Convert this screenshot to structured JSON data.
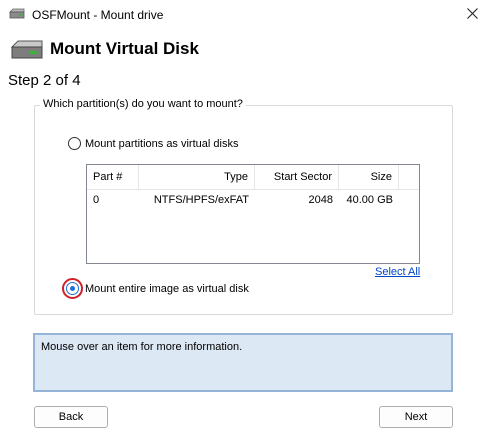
{
  "window": {
    "title": "OSFMount - Mount drive",
    "app_icon": "drive-icon",
    "close_icon": "close-icon"
  },
  "header": {
    "icon": "hard-disk-icon",
    "title": "Mount Virtual Disk",
    "step": "Step 2 of 4"
  },
  "group": {
    "legend": "Which partition(s) do you want to mount?",
    "option_partitions": {
      "label": "Mount partitions as virtual disks",
      "checked": false
    },
    "option_entire": {
      "label": "Mount entire image as virtual disk",
      "checked": true
    },
    "select_all": "Select All"
  },
  "table": {
    "columns": [
      "Part #",
      "Type",
      "Start Sector",
      "Size"
    ],
    "rows": [
      [
        "0",
        "NTFS/HPFS/exFAT",
        "2048",
        "40.00 GB"
      ]
    ]
  },
  "info": {
    "text": "Mouse over an item for more information."
  },
  "buttons": {
    "back": "Back",
    "next": "Next"
  },
  "colors": {
    "accent": "#1f6ed4",
    "focus_ring": "#d0202a",
    "info_bg": "#dde8f5",
    "info_border": "#96b4d7",
    "link": "#0046c8"
  }
}
